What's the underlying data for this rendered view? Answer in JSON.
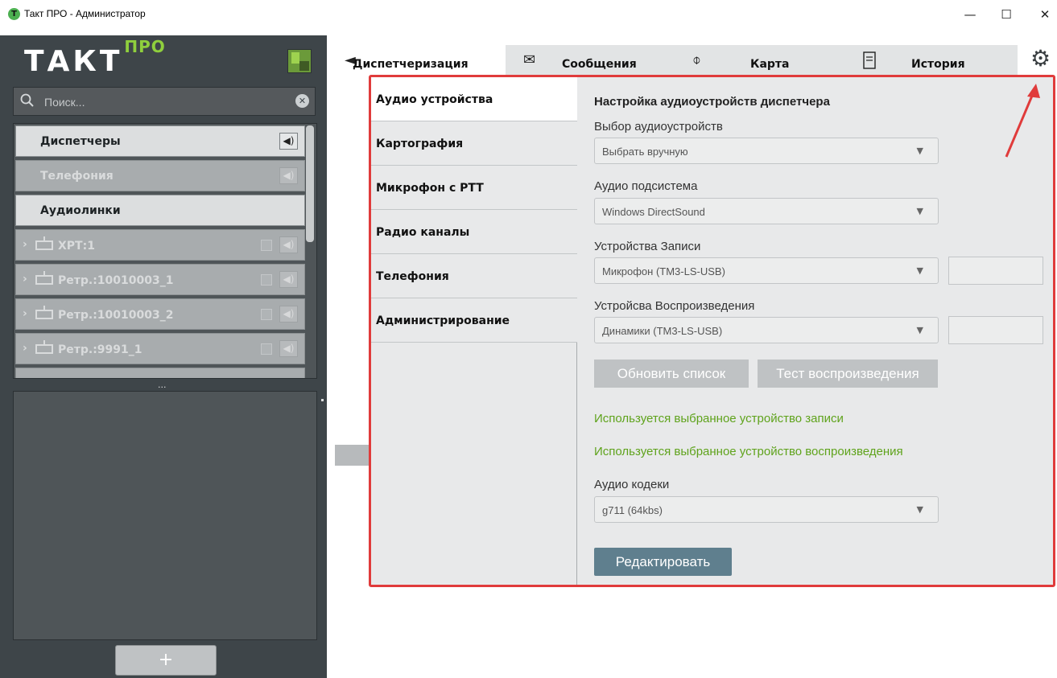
{
  "window": {
    "title": "Такт ПРО - Администратор",
    "app_icon": "T",
    "minimize": "—",
    "maximize": "☐",
    "close": "✕"
  },
  "sidebar": {
    "logo_main": "ТАКТ",
    "logo_sup": "ПРО",
    "search_placeholder": "Поиск...",
    "groups": [
      {
        "label": "Диспетчеры",
        "icon": "speaker-icon"
      },
      {
        "label": "Телефония",
        "icon": "speaker-icon",
        "disabled": true
      },
      {
        "label": "Аудиолинки"
      }
    ],
    "items": [
      {
        "label": "ХРТ:1"
      },
      {
        "label": "Ретр.:10010003_1"
      },
      {
        "label": "Ретр.:10010003_2"
      },
      {
        "label": "Ретр.:9991_1"
      }
    ],
    "splitter": "...",
    "add_label": "+"
  },
  "tabs": [
    {
      "label": "Диспетчеризация",
      "icon": "back-circle-icon",
      "active": true
    },
    {
      "label": "Сообщения",
      "icon": "envelope-icon"
    },
    {
      "label": "Карта",
      "icon": "map-pin-icon"
    },
    {
      "label": "История",
      "icon": "document-icon"
    }
  ],
  "settings": {
    "categories": [
      {
        "label": "Аудио устройства",
        "active": true
      },
      {
        "label": "Картография"
      },
      {
        "label": "Микрофон с PTT"
      },
      {
        "label": "Радио каналы"
      },
      {
        "label": "Телефония"
      },
      {
        "label": "Администрирование"
      }
    ],
    "heading": "Настройка аудиоустройств  диспетчера",
    "fields": {
      "audio_select_label": "Выбор аудиоустройств",
      "audio_select_value": "Выбрать вручную",
      "subsystem_label": "Аудио подсистема",
      "subsystem_value": "Windows DirectSound",
      "record_label": "Устройства Записи",
      "record_value": "Микрофон (TM3-LS-USB)",
      "playback_label": "Устройсва Воспроизведения",
      "playback_value": "Динамики (TM3-LS-USB)",
      "codec_label": "Аудио кодеки",
      "codec_value": "g711 (64kbs)"
    },
    "refresh_button": "Обновить список",
    "test_button": "Тест воспроизведения",
    "status_record": "Используется выбранное устройство записи",
    "status_playback": "Используется выбранное устройство воспроизведения",
    "edit_button": "Редактировать"
  },
  "colors": {
    "sidebar_bg": "#3e4549",
    "highlight_border": "#e03b3b",
    "status_green": "#5fa31c",
    "edit_button": "#5f7f8e",
    "logo_accent": "#8fcf3d"
  }
}
